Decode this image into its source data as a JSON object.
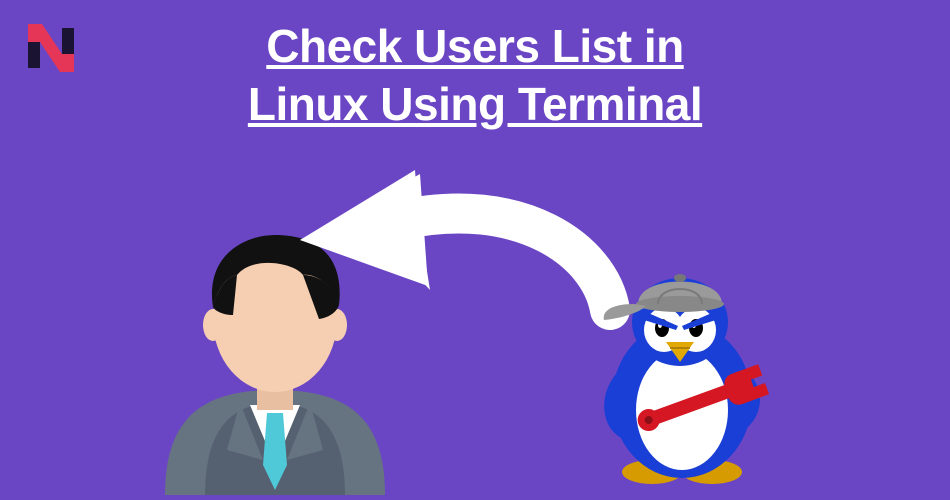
{
  "title": {
    "line1": "Check Users List in",
    "line2": "Linux Using Terminal"
  },
  "logo": {
    "letter": "N"
  },
  "colors": {
    "background": "#6a46c4",
    "title_text": "#ffffff",
    "logo_red": "#e63657",
    "logo_dark": "#1a1432",
    "arrow": "#ffffff",
    "person_skin": "#f6cfb2",
    "person_hair": "#111",
    "person_suit": "#667481",
    "person_tie": "#4fc8d8",
    "penguin_blue": "#1a3fd6",
    "penguin_belly": "#ffffff",
    "penguin_beak": "#e0a800",
    "penguin_cap": "#9a9a9a",
    "wrench": "#d41723"
  }
}
